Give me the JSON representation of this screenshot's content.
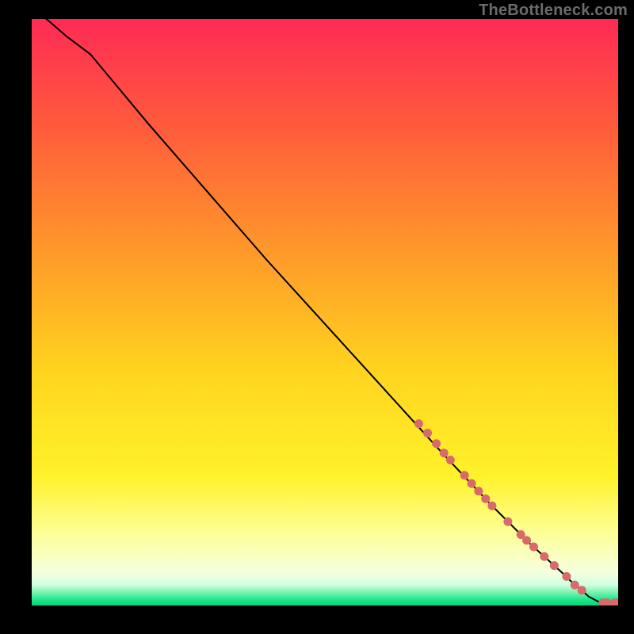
{
  "watermark": "TheBottleneck.com",
  "chart_data": {
    "type": "line",
    "title": "",
    "xlabel": "",
    "ylabel": "",
    "xlim": [
      0,
      100
    ],
    "ylim": [
      0,
      100
    ],
    "grid": false,
    "gradient_stops": [
      {
        "offset": 0,
        "color": "#ff2a55"
      },
      {
        "offset": 0.18,
        "color": "#ff5a3c"
      },
      {
        "offset": 0.4,
        "color": "#ff9a2a"
      },
      {
        "offset": 0.6,
        "color": "#ffd41f"
      },
      {
        "offset": 0.78,
        "color": "#fff22a"
      },
      {
        "offset": 0.88,
        "color": "#fdff9a"
      },
      {
        "offset": 0.945,
        "color": "#f4ffe0"
      },
      {
        "offset": 0.965,
        "color": "#cfffe0"
      },
      {
        "offset": 0.977,
        "color": "#7cf5b0"
      },
      {
        "offset": 0.99,
        "color": "#1ee68c"
      },
      {
        "offset": 1.0,
        "color": "#00d97a"
      }
    ],
    "series": [
      {
        "name": "bottleneck-curve",
        "x": [
          0,
          3,
          6,
          10,
          20,
          30,
          40,
          50,
          60,
          70,
          78,
          85,
          90,
          92,
          94,
          95,
          97,
          100
        ],
        "y": [
          102,
          99.6,
          97,
          94,
          82,
          70.5,
          59,
          48,
          37,
          26,
          17.5,
          10.5,
          6,
          4.1,
          2.4,
          1.5,
          0.45,
          0.45
        ],
        "stroke": "#000000",
        "stroke_width": 2
      }
    ],
    "markers": {
      "name": "highlight-dots",
      "color": "#d86a6a",
      "radius": 5.5,
      "points": [
        {
          "x": 66,
          "y": 31
        },
        {
          "x": 67.5,
          "y": 29.4
        },
        {
          "x": 69,
          "y": 27.6
        },
        {
          "x": 70.3,
          "y": 26
        },
        {
          "x": 71.4,
          "y": 24.8
        },
        {
          "x": 73.8,
          "y": 22.2
        },
        {
          "x": 75,
          "y": 20.8
        },
        {
          "x": 76.2,
          "y": 19.5
        },
        {
          "x": 77.4,
          "y": 18.2
        },
        {
          "x": 78.5,
          "y": 17
        },
        {
          "x": 81.2,
          "y": 14.3
        },
        {
          "x": 83.4,
          "y": 12.1
        },
        {
          "x": 84.4,
          "y": 11.1
        },
        {
          "x": 85.6,
          "y": 10
        },
        {
          "x": 87.4,
          "y": 8.35
        },
        {
          "x": 89.1,
          "y": 6.8
        },
        {
          "x": 91.2,
          "y": 4.95
        },
        {
          "x": 92.6,
          "y": 3.5
        },
        {
          "x": 93.8,
          "y": 2.6
        },
        {
          "x": 97.4,
          "y": 0.45
        },
        {
          "x": 98.1,
          "y": 0.45
        },
        {
          "x": 99.4,
          "y": 0.45
        },
        {
          "x": 100,
          "y": 0.45
        }
      ]
    }
  }
}
